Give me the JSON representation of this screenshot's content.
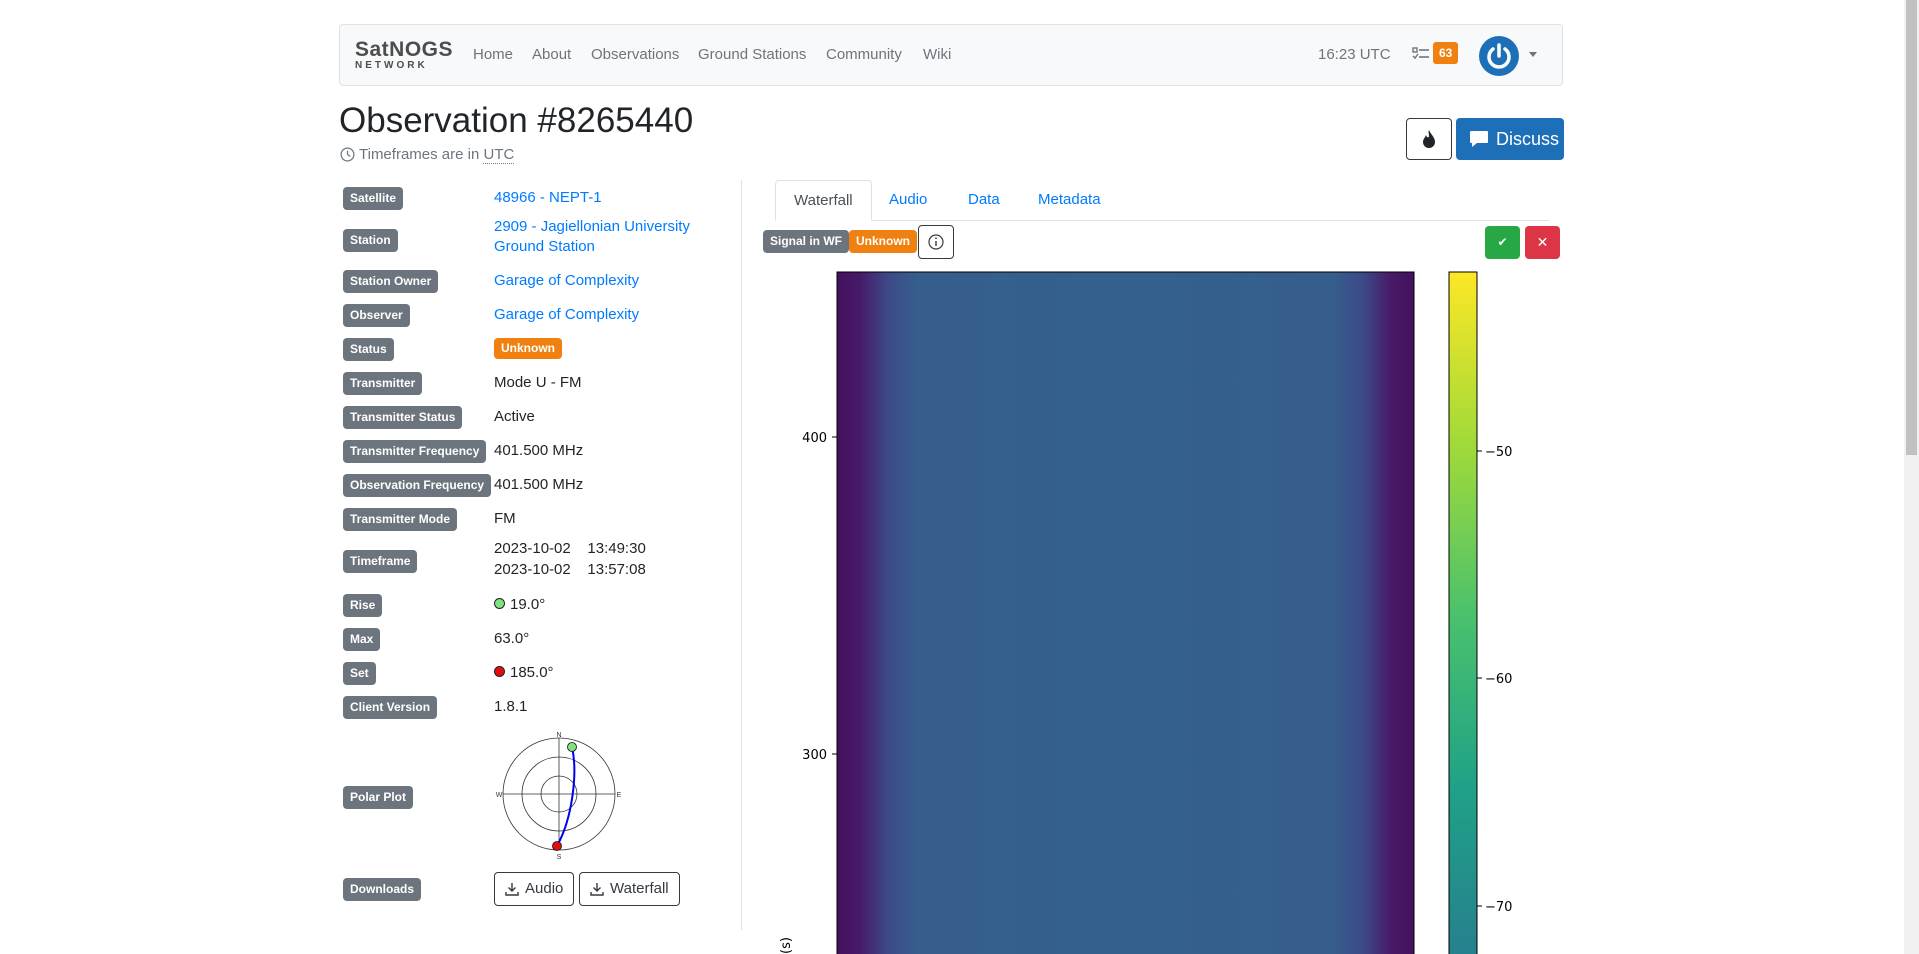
{
  "navbar": {
    "logo_top": "SatNOGS",
    "logo_bottom": "NETWORK",
    "links": [
      "Home",
      "About",
      "Observations",
      "Ground Stations",
      "Community",
      "Wiki"
    ],
    "time": "16:23 UTC",
    "tasks_count": "63",
    "icons": {
      "tasks": "tasks-icon",
      "user": "power-avatar-icon",
      "menu": "caret-down-icon"
    }
  },
  "header": {
    "title": "Observation #8265440",
    "subtitle_prefix": "Timeframes are in",
    "subtitle_tz": "UTC",
    "discuss_label": "Discuss"
  },
  "details": {
    "satellite_label": "Satellite",
    "satellite_value": "48966 - NEPT-1",
    "station_label": "Station",
    "station_value_1": "2909 - Jagiellonian University",
    "station_value_2": "Ground Station",
    "station_owner_label": "Station Owner",
    "station_owner_value": "Garage of Complexity",
    "observer_label": "Observer",
    "observer_value": "Garage of Complexity",
    "status_label": "Status",
    "status_value": "Unknown",
    "transmitter_label": "Transmitter",
    "transmitter_value": "Mode U - FM",
    "transmitter_status_label": "Transmitter Status",
    "transmitter_status_value": "Active",
    "transmitter_freq_label": "Transmitter Frequency",
    "transmitter_freq_value": "401.500 MHz",
    "observation_freq_label": "Observation Frequency",
    "observation_freq_value": "401.500 MHz",
    "transmitter_mode_label": "Transmitter Mode",
    "transmitter_mode_value": "FM",
    "timeframe_label": "Timeframe",
    "timeframe_start": "2023-10-02    13:49:30",
    "timeframe_end": "2023-10-02    13:57:08",
    "rise_label": "Rise",
    "rise_value": "19.0°",
    "max_label": "Max",
    "max_value": "63.0°",
    "set_label": "Set",
    "set_value": "185.0°",
    "client_version_label": "Client Version",
    "client_version_value": "1.8.1",
    "polar_plot_label": "Polar Plot",
    "polar": {
      "n": "N",
      "e": "E",
      "s": "S",
      "w": "W"
    },
    "downloads_label": "Downloads",
    "download_audio": "Audio",
    "download_waterfall": "Waterfall"
  },
  "tabs": [
    "Waterfall",
    "Audio",
    "Data",
    "Metadata"
  ],
  "waterfall": {
    "badge_signal": "Signal in WF",
    "badge_status": "Unknown",
    "y_ticks": [
      "400",
      "300"
    ],
    "colorbar_ticks": [
      "−50",
      "−60",
      "−70"
    ],
    "y_axis_label_fragment": "(s)"
  },
  "colors": {
    "primary": "#007bff",
    "discuss": "#1d6fb8",
    "unknown": "#f0800f",
    "good": "#28a745",
    "bad": "#dc3545",
    "label_bg": "#6c757d"
  }
}
